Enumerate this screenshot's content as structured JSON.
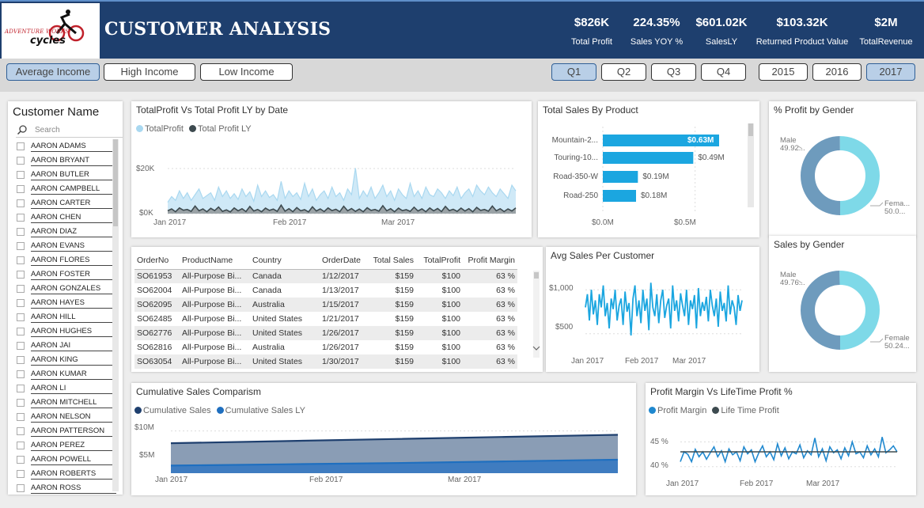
{
  "header": {
    "logo_line1": "ADVENTURE WORKS",
    "logo_line2": "cycles",
    "title": "CUSTOMER ANALYSIS",
    "kpis": [
      {
        "value": "$826K",
        "label": "Total Profit"
      },
      {
        "value": "224.35%",
        "label": "Sales YOY %"
      },
      {
        "value": "$601.02K",
        "label": "SalesLY"
      },
      {
        "value": "$103.32K",
        "label": "Returned Product Value"
      },
      {
        "value": "$2M",
        "label": "TotalRevenue"
      }
    ]
  },
  "slicers": {
    "income": [
      {
        "label": "Average Income",
        "selected": true
      },
      {
        "label": "High Income",
        "selected": false
      },
      {
        "label": "Low Income",
        "selected": false
      }
    ],
    "quarters": [
      {
        "label": "Q1",
        "selected": true
      },
      {
        "label": "Q2",
        "selected": false
      },
      {
        "label": "Q3",
        "selected": false
      },
      {
        "label": "Q4",
        "selected": false
      }
    ],
    "years": [
      {
        "label": "2015",
        "selected": false
      },
      {
        "label": "2016",
        "selected": false
      },
      {
        "label": "2017",
        "selected": true
      }
    ]
  },
  "customers": {
    "title": "Customer Name",
    "search_placeholder": "Search",
    "names": [
      "AARON ADAMS",
      "AARON BRYANT",
      "AARON BUTLER",
      "AARON CAMPBELL",
      "AARON CARTER",
      "AARON CHEN",
      "AARON DIAZ",
      "AARON EVANS",
      "AARON FLORES",
      "AARON FOSTER",
      "AARON GONZALES",
      "AARON HAYES",
      "AARON HILL",
      "AARON HUGHES",
      "AARON JAI",
      "AARON KING",
      "AARON KUMAR",
      "AARON LI",
      "AARON MITCHELL",
      "AARON NELSON",
      "AARON PATTERSON",
      "AARON PEREZ",
      "AARON POWELL",
      "AARON ROBERTS",
      "AARON ROSS"
    ]
  },
  "profit_chart": {
    "title": "TotalProfit Vs Total Profit LY by Date",
    "legend": [
      {
        "name": "TotalProfit",
        "color": "#a9d8f0"
      },
      {
        "name": "Total Profit LY",
        "color": "#3d4a4f"
      }
    ],
    "y_ticks": [
      "$20K",
      "$0K"
    ],
    "x_ticks": [
      "Jan 2017",
      "Feb 2017",
      "Mar 2017"
    ]
  },
  "product_chart": {
    "title": "Total Sales By Product",
    "x_ticks": [
      "$0.0M",
      "$0.5M"
    ],
    "color": "#1ba6e0"
  },
  "gender_profit": {
    "title": "% Profit by Gender",
    "male_label": "Male",
    "male_value": "49.92...",
    "female_label": "Fema...",
    "female_value": "50.0...",
    "colors": [
      "#6e9bbd",
      "#7ed9e8"
    ]
  },
  "gender_sales": {
    "title": "Sales by Gender",
    "male_label": "Male",
    "male_value": "49.76...",
    "female_label": "Female",
    "female_value": "50.24...",
    "colors": [
      "#6e9bbd",
      "#7ed9e8"
    ]
  },
  "orders_table": {
    "headers": [
      "OrderNo",
      "ProductName",
      "Country",
      "OrderDate",
      "Total Sales",
      "TotalProfit",
      "Profit Margin"
    ],
    "rows": [
      [
        "SO61953",
        "All-Purpose Bi...",
        "Canada",
        "1/12/2017",
        "$159",
        "$100",
        "63 %"
      ],
      [
        "SO62004",
        "All-Purpose Bi...",
        "Canada",
        "1/13/2017",
        "$159",
        "$100",
        "63 %"
      ],
      [
        "SO62095",
        "All-Purpose Bi...",
        "Australia",
        "1/15/2017",
        "$159",
        "$100",
        "63 %"
      ],
      [
        "SO62485",
        "All-Purpose Bi...",
        "United States",
        "1/21/2017",
        "$159",
        "$100",
        "63 %"
      ],
      [
        "SO62776",
        "All-Purpose Bi...",
        "United States",
        "1/26/2017",
        "$159",
        "$100",
        "63 %"
      ],
      [
        "SO62816",
        "All-Purpose Bi...",
        "Australia",
        "1/26/2017",
        "$159",
        "$100",
        "63 %"
      ],
      [
        "SO63054",
        "All-Purpose Bi...",
        "United States",
        "1/30/2017",
        "$159",
        "$100",
        "63 %"
      ]
    ]
  },
  "avg_sales": {
    "title": "Avg Sales Per Customer",
    "y_ticks": [
      "$1,000",
      "$500"
    ],
    "x_ticks": [
      "Jan 2017",
      "Feb 2017",
      "Mar 2017"
    ],
    "color": "#1ba6e0"
  },
  "cumulative": {
    "title": "Cumulative Sales Comparism",
    "legend": [
      {
        "name": "Cumulative Sales",
        "color": "#1e3f6e"
      },
      {
        "name": "Cumulative Sales LY",
        "color": "#1f6fbf"
      }
    ],
    "y_ticks": [
      "$10M",
      "$5M"
    ],
    "x_ticks": [
      "Jan 2017",
      "Feb 2017",
      "Mar 2017"
    ]
  },
  "margin_chart": {
    "title": "Profit Margin Vs LifeTime Profit %",
    "legend": [
      {
        "name": "Profit Margin",
        "color": "#1f88cf"
      },
      {
        "name": "Life Time Profit",
        "color": "#3d4a4f"
      }
    ],
    "y_ticks": [
      "45 %",
      "40 %"
    ],
    "x_ticks": [
      "Jan 2017",
      "Feb 2017",
      "Mar 2017"
    ]
  },
  "chart_data": [
    {
      "type": "area",
      "title": "TotalProfit Vs Total Profit LY by Date",
      "ylim": [
        0,
        30000
      ],
      "x_range": [
        "2017-01-01",
        "2017-03-31"
      ],
      "series": [
        {
          "name": "TotalProfit",
          "values": [
            6000,
            9000,
            7000,
            12000,
            8000,
            11000,
            7000,
            10000,
            13000,
            8000,
            9500,
            11000,
            7000,
            14000,
            9000,
            12000,
            8000,
            10500,
            7500,
            13000,
            9000,
            11500,
            6500,
            15000,
            9000,
            12000,
            8500,
            10000,
            7000,
            17000,
            8000,
            12000,
            9000,
            11000,
            7500,
            16000,
            9000,
            13000,
            7000,
            10000,
            12000,
            8000,
            14000,
            9000,
            11000,
            7000,
            13000,
            10000,
            24000,
            8000,
            12000,
            9000,
            14000,
            8000,
            11000,
            15000,
            9000,
            12000,
            7000,
            13000,
            10000,
            8000,
            16000,
            9000,
            12000,
            8000,
            14000,
            10000,
            9000,
            13000,
            11000,
            8000,
            12000,
            9500,
            14000,
            8000,
            11000,
            13000,
            9000,
            15000,
            12000,
            10000,
            14000,
            11000,
            9000,
            13000,
            10500,
            8000,
            15000,
            12000
          ]
        },
        {
          "name": "Total Profit LY",
          "values": [
            1500,
            2500,
            1000,
            3000,
            1800,
            2200,
            1200,
            4000,
            1500,
            2500,
            1000,
            2800,
            1600,
            3500,
            1200,
            2000,
            900,
            3000,
            1500,
            2600,
            1100,
            3800,
            1400,
            2200,
            1000,
            2900,
            1700,
            2400,
            1200,
            4500,
            1300,
            2600,
            1000,
            3200,
            1500,
            2100,
            900,
            3600,
            1400,
            2500,
            1100,
            3000,
            1600,
            2300,
            1000,
            3900,
            1500,
            2700,
            1200,
            2400,
            1000,
            3100,
            1700,
            2200,
            1300,
            4200,
            1500,
            2600,
            1000,
            2900,
            1600,
            2100,
            1200,
            3400,
            1400,
            2500,
            1000,
            3000,
            1500,
            2700,
            1100,
            3800,
            1600,
            2300,
            1200,
            2900,
            1400,
            2600,
            1000,
            3300,
            1700,
            2200,
            1300,
            4000,
            1500,
            2600,
            1100,
            2500,
            1400,
            3000
          ]
        }
      ]
    },
    {
      "type": "bar",
      "title": "Total Sales By Product",
      "categories": [
        "Mountain-2...",
        "Touring-10...",
        "Road-350-W",
        "Road-250"
      ],
      "values": [
        0.63,
        0.49,
        0.19,
        0.18
      ],
      "value_labels": [
        "$0.63M",
        "$0.49M",
        "$0.19M",
        "$0.18M"
      ],
      "xlim": [
        0,
        0.9
      ]
    },
    {
      "type": "pie",
      "title": "% Profit by Gender",
      "categories": [
        "Male",
        "Female"
      ],
      "values": [
        49.92,
        50.08
      ]
    },
    {
      "type": "pie",
      "title": "Sales by Gender",
      "categories": [
        "Male",
        "Female"
      ],
      "values": [
        49.76,
        50.24
      ]
    },
    {
      "type": "line",
      "title": "Avg Sales Per Customer",
      "ylim": [
        300,
        1200
      ],
      "x_range": [
        "2017-01-01",
        "2017-03-31"
      ],
      "series": [
        {
          "name": "Avg Sales",
          "values": [
            800,
            950,
            650,
            1000,
            720,
            880,
            600,
            950,
            800,
            1050,
            700,
            850,
            560,
            900,
            780,
            1000,
            650,
            820,
            900,
            600,
            980,
            750,
            850,
            480,
            900,
            1050,
            700,
            880,
            620,
            1000,
            760,
            900,
            540,
            1080,
            800,
            700,
            950,
            620,
            880,
            1000,
            680,
            820,
            900,
            560,
            1050,
            760,
            880,
            640,
            960,
            820,
            700,
            1000,
            600,
            880,
            780,
            940,
            560,
            1020,
            700,
            860,
            760,
            920,
            640,
            1000,
            820,
            700,
            900,
            580,
            980,
            760,
            850,
            640,
            1050,
            720,
            880,
            800,
            600,
            940,
            760,
            880
          ]
        }
      ]
    },
    {
      "type": "area",
      "title": "Cumulative Sales Comparism",
      "ylim": [
        0,
        12000000
      ],
      "x_range": [
        "2017-01-01",
        "2017-03-31"
      ],
      "series": [
        {
          "name": "Cumulative Sales",
          "values": [
            7100000,
            7600000,
            8100000,
            8600000,
            9100000
          ]
        },
        {
          "name": "Cumulative Sales LY",
          "values": [
            1800000,
            2100000,
            2400000,
            2800000,
            3200000
          ]
        }
      ]
    },
    {
      "type": "line",
      "title": "Profit Margin Vs LifeTime Profit %",
      "ylim": [
        39,
        47
      ],
      "x_range": [
        "2017-01-01",
        "2017-03-31"
      ],
      "series": [
        {
          "name": "Profit Margin",
          "values": [
            41,
            43,
            42.5,
            41,
            43.5,
            42,
            43,
            41.5,
            42.8,
            44,
            42,
            43.2,
            41,
            43.6,
            42.4,
            43,
            41.2,
            44,
            42.6,
            43.4,
            41,
            42.8,
            44.2,
            42,
            43,
            41.4,
            44.6,
            42.2,
            43.8,
            41.6,
            43,
            42.6,
            44.4,
            41.8,
            43.2,
            42.4,
            45.8,
            42,
            43.6,
            41.2,
            44,
            42.8,
            43.4,
            41.6,
            43.8,
            42.2,
            45,
            42.6,
            43,
            41.8,
            44.2,
            42.4,
            43.6,
            42,
            46,
            42.8,
            43.4,
            44.2,
            43
          ]
        },
        {
          "name": "Life Time Profit",
          "values": [
            43,
            43,
            43,
            43,
            43,
            43,
            43,
            43,
            43,
            43,
            43,
            43,
            43,
            43,
            43,
            43,
            43,
            43,
            43,
            43,
            43,
            43,
            43,
            43,
            43,
            43,
            43,
            43,
            43,
            43,
            43,
            43,
            43,
            43,
            43,
            43,
            43,
            43,
            43,
            43,
            43,
            43,
            43,
            43,
            43,
            43,
            43,
            43,
            43,
            43,
            43,
            43,
            43,
            43,
            43,
            43,
            43,
            43,
            43
          ]
        }
      ]
    }
  ]
}
